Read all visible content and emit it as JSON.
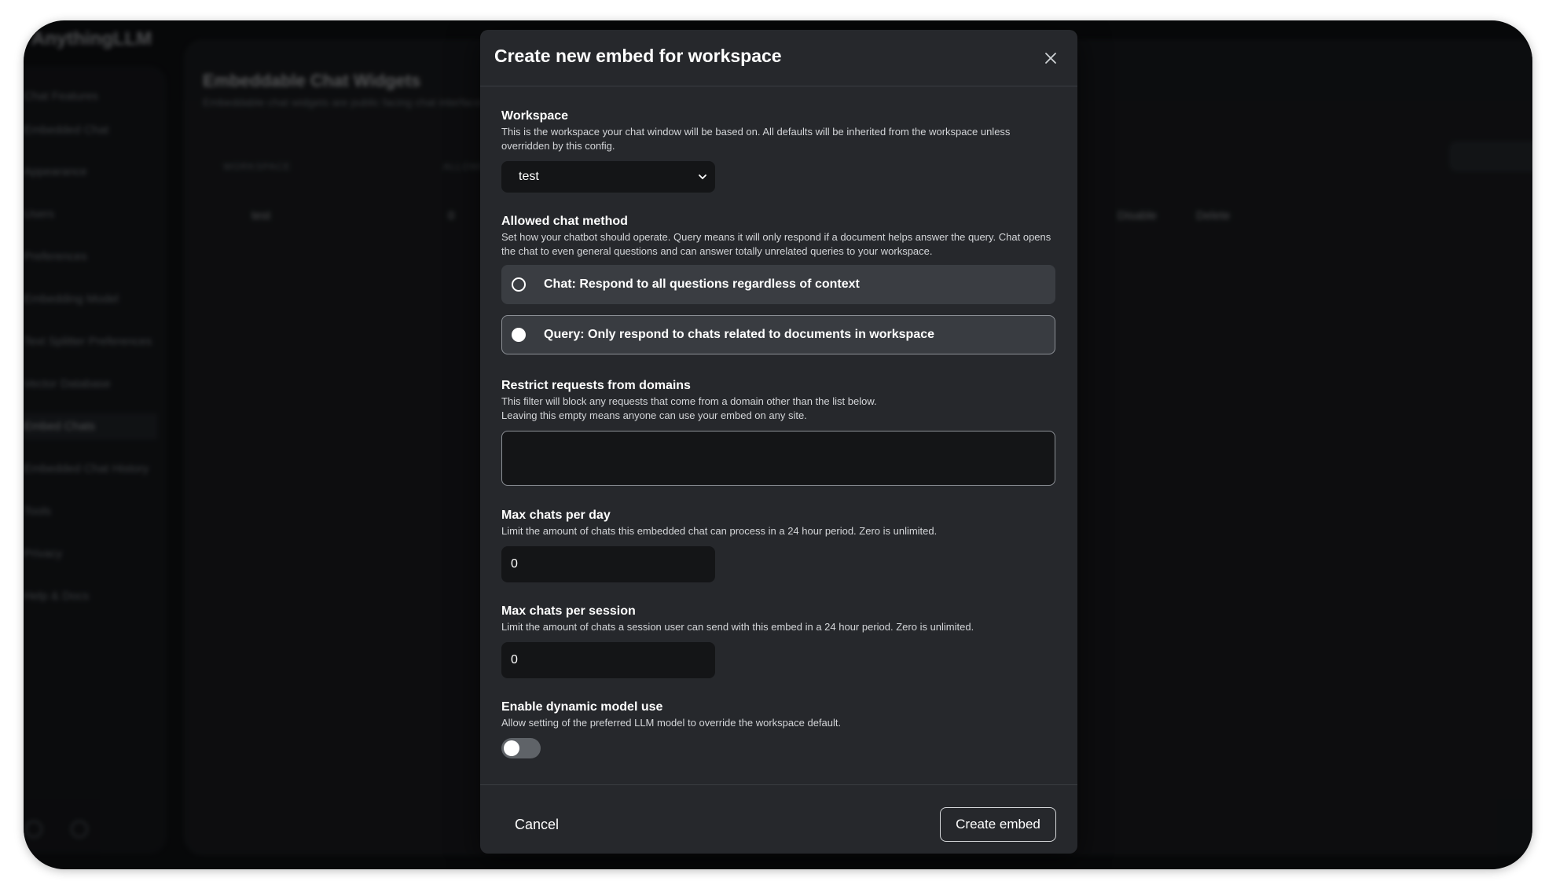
{
  "background": {
    "brand": "AnythingLLM",
    "sidebar_items": [
      "Chat Features",
      "Embedded Chat",
      "Appearance",
      "Users",
      "Preferences",
      "Embedding Model",
      "Text Splitter Preferences",
      "Vector Database",
      "Embed Chats",
      "Embedded Chat History",
      "Tools",
      "Privacy",
      "Help & Docs"
    ],
    "page_title": "Embeddable Chat Widgets",
    "page_subtitle": "Embeddable chat widgets are public facing chat interfaces",
    "table_headers": [
      "WORKSPACE",
      "ALLOWED DOMAINS"
    ],
    "row": {
      "workspace": "test",
      "domains": "0",
      "action_disable": "Disable",
      "action_delete": "Delete"
    }
  },
  "modal": {
    "title": "Create new embed for workspace",
    "workspace": {
      "label": "Workspace",
      "description": "This is the workspace your chat window will be based on. All defaults will be inherited from the workspace unless overridden by this config.",
      "selected": "test"
    },
    "chat_method": {
      "label": "Allowed chat method",
      "description": "Set how your chatbot should operate. Query means it will only respond if a document helps answer the query. Chat opens the chat to even general questions and can answer totally unrelated queries to your workspace.",
      "options": [
        {
          "label": "Chat: Respond to all questions regardless of context",
          "selected": false
        },
        {
          "label": "Query: Only respond to chats related to documents in workspace",
          "selected": true
        }
      ]
    },
    "domains": {
      "label": "Restrict requests from domains",
      "description_line1": "This filter will block any requests that come from a domain other than the list below.",
      "description_line2": "Leaving this empty means anyone can use your embed on any site.",
      "value": ""
    },
    "max_chats_day": {
      "label": "Max chats per day",
      "description": "Limit the amount of chats this embedded chat can process in a 24 hour period. Zero is unlimited.",
      "value": "0"
    },
    "max_chats_session": {
      "label": "Max chats per session",
      "description": "Limit the amount of chats a session user can send with this embed in a 24 hour period. Zero is unlimited.",
      "value": "0"
    },
    "dynamic_model": {
      "label": "Enable dynamic model use",
      "description": "Allow setting of the preferred LLM model to override the workspace default.",
      "enabled": false
    },
    "cancel_label": "Cancel",
    "create_label": "Create embed"
  },
  "colors": {
    "modal_bg": "#26282c",
    "input_bg": "#141517",
    "page_bg": "#0c0d0f"
  }
}
